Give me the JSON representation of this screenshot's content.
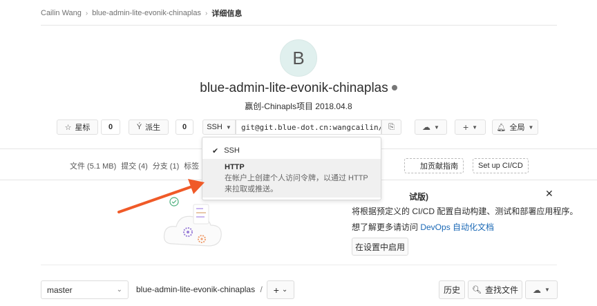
{
  "breadcrumb": {
    "user": "Cailin Wang",
    "project": "blue-admin-lite-evonik-chinaplas",
    "current": "详细信息"
  },
  "project": {
    "avatar_letter": "B",
    "name": "blue-admin-lite-evonik-chinaplas",
    "description": "赢创-Chinapls项目 2018.04.8"
  },
  "actions": {
    "star_label": "星标",
    "star_count": "0",
    "fork_label": "派生",
    "fork_count": "0",
    "protocol": "SSH",
    "clone_url": "git@git.blue-dot.cn:wangcailin/blue-admin-lite-evonik-chinaplas.git",
    "notify_label": "全局"
  },
  "nav": {
    "files": "文件 (5.1 MB)",
    "commits": "提交 (4)",
    "branches": "分支 (1)",
    "tags_partial": "标签",
    "contrib_partial": "加贡献指南",
    "setup_cicd": "Set up CI/CD"
  },
  "dropdown": {
    "ssh_label": "SSH",
    "http_label": "HTTP",
    "http_desc": "在帐户上创建个人访问令牌，以通过 HTTP 来拉取或推送。"
  },
  "banner": {
    "title_partial": "试版)",
    "line1": "将根据预定义的 CI/CD 配置自动构建、测试和部署应用程序。",
    "line2_prefix": "想了解更多请访问 ",
    "line2_link": "DevOps 自动化文档",
    "enable_button": "在设置中启用"
  },
  "bottom": {
    "branch": "master",
    "path": "blue-admin-lite-evonik-chinaplas",
    "path_sep": "/",
    "history": "历史",
    "find_file": "查找文件"
  },
  "colors": {
    "link": "#1b69b6",
    "arrow": "#f05a28",
    "avatar_bg": "#e0f0ee"
  }
}
